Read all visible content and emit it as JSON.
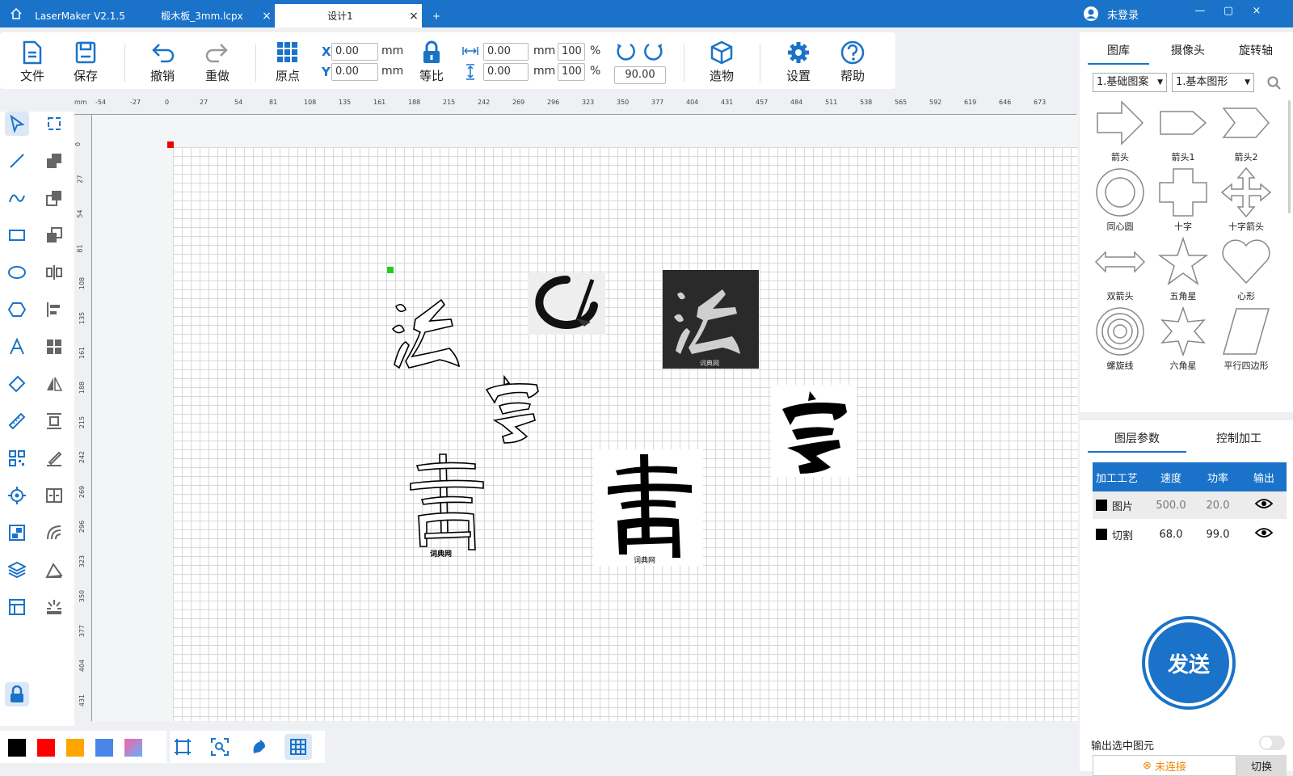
{
  "titlebar": {
    "app": "LaserMaker V2.1.5",
    "tab_file": "椴木板_3mm.lcpx",
    "tab_design": "设计1",
    "user": "未登录"
  },
  "toolbar": {
    "file": "文件",
    "save": "保存",
    "undo": "撤销",
    "redo": "重做",
    "origin": "原点",
    "proportional": "等比",
    "build": "造物",
    "settings": "设置",
    "help": "帮助",
    "x_label": "X",
    "y_label": "Y",
    "x_value": "0.00",
    "y_value": "0.00",
    "w_value": "0.00",
    "h_value": "0.00",
    "w_pct": "100",
    "h_pct": "100",
    "unit": "mm",
    "pct": "%",
    "rotate": "90.00"
  },
  "ruler": {
    "unit": "mm",
    "top_ticks": [
      "-54",
      "-27",
      "0",
      "27",
      "54",
      "81",
      "108",
      "135",
      "161",
      "188",
      "215",
      "242",
      "269",
      "296",
      "323",
      "350",
      "377",
      "404",
      "431",
      "457",
      "484",
      "511",
      "538",
      "565",
      "592",
      "619",
      "646",
      "673"
    ],
    "left_ticks": [
      "0",
      "27",
      "54",
      "81",
      "108",
      "135",
      "161",
      "188",
      "215",
      "242",
      "269",
      "296",
      "323",
      "350",
      "377",
      "404",
      "431"
    ]
  },
  "library": {
    "tabs": [
      "图库",
      "摄像头",
      "旋转轴"
    ],
    "category": "1.基础图案",
    "subcategory": "1.基本图形",
    "shapes": [
      "箭头",
      "箭头1",
      "箭头2",
      "同心圆",
      "十字",
      "十字箭头",
      "双箭头",
      "五角星",
      "心形",
      "螺旋线",
      "六角星",
      "平行四边形"
    ]
  },
  "layers": {
    "tabs": [
      "图层参数",
      "控制加工"
    ],
    "headers": [
      "加工工艺",
      "速度",
      "功率",
      "输出"
    ],
    "rows": [
      {
        "name": "图片",
        "speed": "500.0",
        "power": "20.0"
      },
      {
        "name": "切割",
        "speed": "68.0",
        "power": "99.0"
      }
    ]
  },
  "send": {
    "label": "发送",
    "output_selected": "输出选中图元",
    "connection": "未连接",
    "switch": "切换"
  },
  "canvas": {
    "watermark": "词典网"
  },
  "colors": {
    "primary": "#1a73c8",
    "palette": [
      "#000000",
      "#ff0000",
      "#ffa500",
      "#4a86e8",
      "#d070d0"
    ]
  }
}
